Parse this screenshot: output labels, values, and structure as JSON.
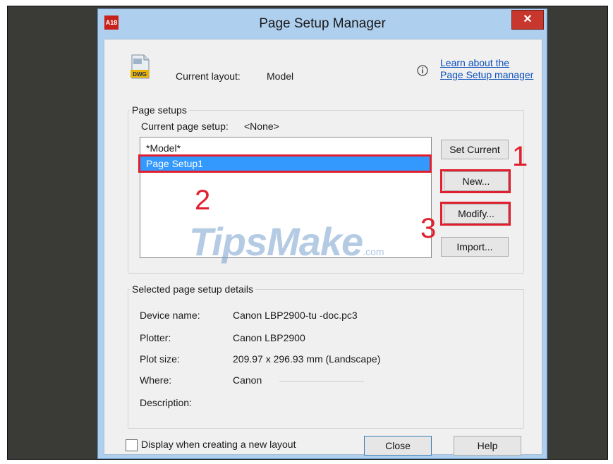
{
  "window": {
    "title": "Page Setup Manager",
    "close_glyph": "✕",
    "app_icon_text": "A18"
  },
  "header": {
    "icon_text": "DWG",
    "current_layout_label": "Current layout:",
    "current_layout_value": "Model",
    "learn_link_line1": "Learn about the",
    "learn_link_line2": "Page Setup manager"
  },
  "page_setups": {
    "group_label": "Page setups",
    "current_label": "Current page setup:",
    "current_value": "<None>",
    "items": [
      "*Model*",
      "Page Setup1"
    ],
    "selected_index": 1,
    "buttons": {
      "set_current": "Set Current",
      "new": "New...",
      "modify": "Modify...",
      "import": "Import..."
    }
  },
  "annotations": {
    "one": "1",
    "two": "2",
    "three": "3",
    "highlight_color": "#e0202e"
  },
  "watermark": {
    "main": "TipsMake",
    "suffix": ".com"
  },
  "details": {
    "group_label": "Selected page setup details",
    "rows": [
      {
        "label": "Device name:",
        "value": "Canon LBP2900-tu -doc.pc3"
      },
      {
        "label": "Plotter:",
        "value": "Canon LBP2900"
      },
      {
        "label": "Plot size:",
        "value": "209.97 x 296.93 mm (Landscape)"
      },
      {
        "label": "Where:",
        "value": "Canon"
      },
      {
        "label": "Description:",
        "value": ""
      }
    ]
  },
  "footer": {
    "checkbox_label": "Display when creating a new layout",
    "checkbox_checked": false,
    "close": "Close",
    "help": "Help"
  },
  "colors": {
    "selection": "#3399ff",
    "link": "#0b4fbd",
    "title_bar": "#aecfee",
    "close": "#c8372d"
  }
}
